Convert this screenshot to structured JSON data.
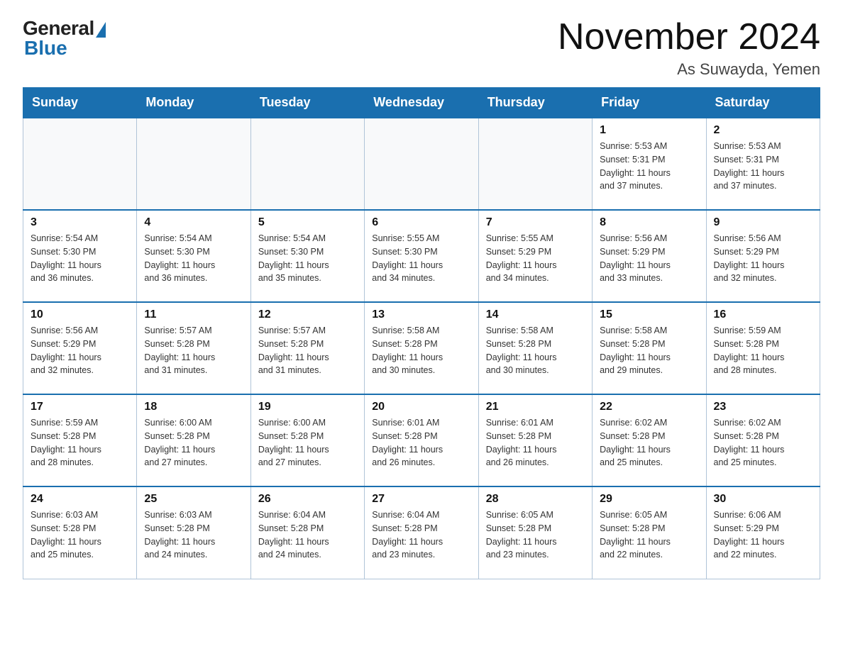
{
  "logo": {
    "general": "General",
    "blue": "Blue"
  },
  "title": "November 2024",
  "subtitle": "As Suwayda, Yemen",
  "days_of_week": [
    "Sunday",
    "Monday",
    "Tuesday",
    "Wednesday",
    "Thursday",
    "Friday",
    "Saturday"
  ],
  "weeks": [
    [
      {
        "day": "",
        "info": ""
      },
      {
        "day": "",
        "info": ""
      },
      {
        "day": "",
        "info": ""
      },
      {
        "day": "",
        "info": ""
      },
      {
        "day": "",
        "info": ""
      },
      {
        "day": "1",
        "info": "Sunrise: 5:53 AM\nSunset: 5:31 PM\nDaylight: 11 hours\nand 37 minutes."
      },
      {
        "day": "2",
        "info": "Sunrise: 5:53 AM\nSunset: 5:31 PM\nDaylight: 11 hours\nand 37 minutes."
      }
    ],
    [
      {
        "day": "3",
        "info": "Sunrise: 5:54 AM\nSunset: 5:30 PM\nDaylight: 11 hours\nand 36 minutes."
      },
      {
        "day": "4",
        "info": "Sunrise: 5:54 AM\nSunset: 5:30 PM\nDaylight: 11 hours\nand 36 minutes."
      },
      {
        "day": "5",
        "info": "Sunrise: 5:54 AM\nSunset: 5:30 PM\nDaylight: 11 hours\nand 35 minutes."
      },
      {
        "day": "6",
        "info": "Sunrise: 5:55 AM\nSunset: 5:30 PM\nDaylight: 11 hours\nand 34 minutes."
      },
      {
        "day": "7",
        "info": "Sunrise: 5:55 AM\nSunset: 5:29 PM\nDaylight: 11 hours\nand 34 minutes."
      },
      {
        "day": "8",
        "info": "Sunrise: 5:56 AM\nSunset: 5:29 PM\nDaylight: 11 hours\nand 33 minutes."
      },
      {
        "day": "9",
        "info": "Sunrise: 5:56 AM\nSunset: 5:29 PM\nDaylight: 11 hours\nand 32 minutes."
      }
    ],
    [
      {
        "day": "10",
        "info": "Sunrise: 5:56 AM\nSunset: 5:29 PM\nDaylight: 11 hours\nand 32 minutes."
      },
      {
        "day": "11",
        "info": "Sunrise: 5:57 AM\nSunset: 5:28 PM\nDaylight: 11 hours\nand 31 minutes."
      },
      {
        "day": "12",
        "info": "Sunrise: 5:57 AM\nSunset: 5:28 PM\nDaylight: 11 hours\nand 31 minutes."
      },
      {
        "day": "13",
        "info": "Sunrise: 5:58 AM\nSunset: 5:28 PM\nDaylight: 11 hours\nand 30 minutes."
      },
      {
        "day": "14",
        "info": "Sunrise: 5:58 AM\nSunset: 5:28 PM\nDaylight: 11 hours\nand 30 minutes."
      },
      {
        "day": "15",
        "info": "Sunrise: 5:58 AM\nSunset: 5:28 PM\nDaylight: 11 hours\nand 29 minutes."
      },
      {
        "day": "16",
        "info": "Sunrise: 5:59 AM\nSunset: 5:28 PM\nDaylight: 11 hours\nand 28 minutes."
      }
    ],
    [
      {
        "day": "17",
        "info": "Sunrise: 5:59 AM\nSunset: 5:28 PM\nDaylight: 11 hours\nand 28 minutes."
      },
      {
        "day": "18",
        "info": "Sunrise: 6:00 AM\nSunset: 5:28 PM\nDaylight: 11 hours\nand 27 minutes."
      },
      {
        "day": "19",
        "info": "Sunrise: 6:00 AM\nSunset: 5:28 PM\nDaylight: 11 hours\nand 27 minutes."
      },
      {
        "day": "20",
        "info": "Sunrise: 6:01 AM\nSunset: 5:28 PM\nDaylight: 11 hours\nand 26 minutes."
      },
      {
        "day": "21",
        "info": "Sunrise: 6:01 AM\nSunset: 5:28 PM\nDaylight: 11 hours\nand 26 minutes."
      },
      {
        "day": "22",
        "info": "Sunrise: 6:02 AM\nSunset: 5:28 PM\nDaylight: 11 hours\nand 25 minutes."
      },
      {
        "day": "23",
        "info": "Sunrise: 6:02 AM\nSunset: 5:28 PM\nDaylight: 11 hours\nand 25 minutes."
      }
    ],
    [
      {
        "day": "24",
        "info": "Sunrise: 6:03 AM\nSunset: 5:28 PM\nDaylight: 11 hours\nand 25 minutes."
      },
      {
        "day": "25",
        "info": "Sunrise: 6:03 AM\nSunset: 5:28 PM\nDaylight: 11 hours\nand 24 minutes."
      },
      {
        "day": "26",
        "info": "Sunrise: 6:04 AM\nSunset: 5:28 PM\nDaylight: 11 hours\nand 24 minutes."
      },
      {
        "day": "27",
        "info": "Sunrise: 6:04 AM\nSunset: 5:28 PM\nDaylight: 11 hours\nand 23 minutes."
      },
      {
        "day": "28",
        "info": "Sunrise: 6:05 AM\nSunset: 5:28 PM\nDaylight: 11 hours\nand 23 minutes."
      },
      {
        "day": "29",
        "info": "Sunrise: 6:05 AM\nSunset: 5:28 PM\nDaylight: 11 hours\nand 22 minutes."
      },
      {
        "day": "30",
        "info": "Sunrise: 6:06 AM\nSunset: 5:29 PM\nDaylight: 11 hours\nand 22 minutes."
      }
    ]
  ]
}
